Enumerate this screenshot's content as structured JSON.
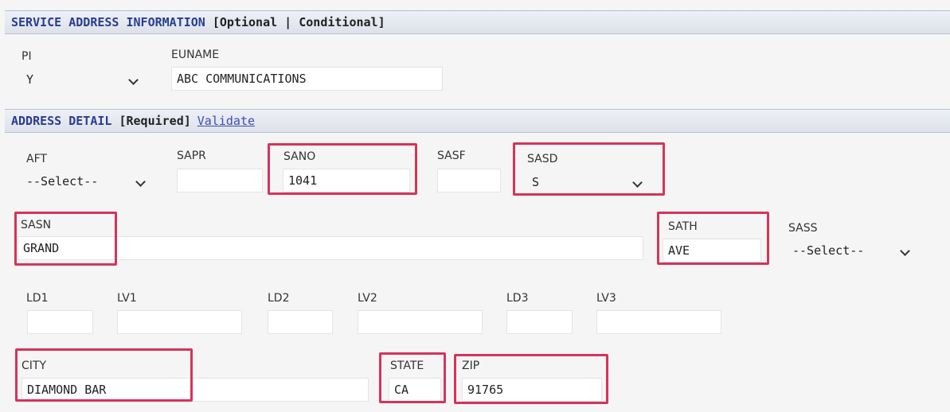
{
  "sections": {
    "service": {
      "title": "SERVICE ADDRESS INFORMATION",
      "qualifier": "[Optional | Conditional]"
    },
    "address": {
      "title": "ADDRESS DETAIL",
      "qualifier": "[Required]",
      "validate_link": "Validate"
    }
  },
  "fields": {
    "pi": {
      "label": "PI",
      "value": "Y"
    },
    "euname": {
      "label": "EUNAME",
      "value": "ABC COMMUNICATIONS"
    },
    "aft": {
      "label": "AFT",
      "value": "--Select--"
    },
    "sapr": {
      "label": "SAPR",
      "value": ""
    },
    "sano": {
      "label": "SANO",
      "value": "1041"
    },
    "sasf": {
      "label": "SASF",
      "value": ""
    },
    "sasd": {
      "label": "SASD",
      "value": "S"
    },
    "sasn": {
      "label": "SASN",
      "value": "GRAND"
    },
    "sath": {
      "label": "SATH",
      "value": "AVE"
    },
    "sass": {
      "label": "SASS",
      "value": "--Select--"
    },
    "ld1": {
      "label": "LD1",
      "value": ""
    },
    "lv1": {
      "label": "LV1",
      "value": ""
    },
    "ld2": {
      "label": "LD2",
      "value": ""
    },
    "lv2": {
      "label": "LV2",
      "value": ""
    },
    "ld3": {
      "label": "LD3",
      "value": ""
    },
    "lv3": {
      "label": "LV3",
      "value": ""
    },
    "city": {
      "label": "CITY",
      "value": "DIAMOND BAR"
    },
    "state": {
      "label": "STATE",
      "value": "CA"
    },
    "zip": {
      "label": "ZIP",
      "value": "91765"
    }
  },
  "colors": {
    "highlight": "#d6335a",
    "section_title": "#2a3d8f",
    "link": "#3a50b4"
  },
  "icons": [
    "chevron-down-icon"
  ]
}
